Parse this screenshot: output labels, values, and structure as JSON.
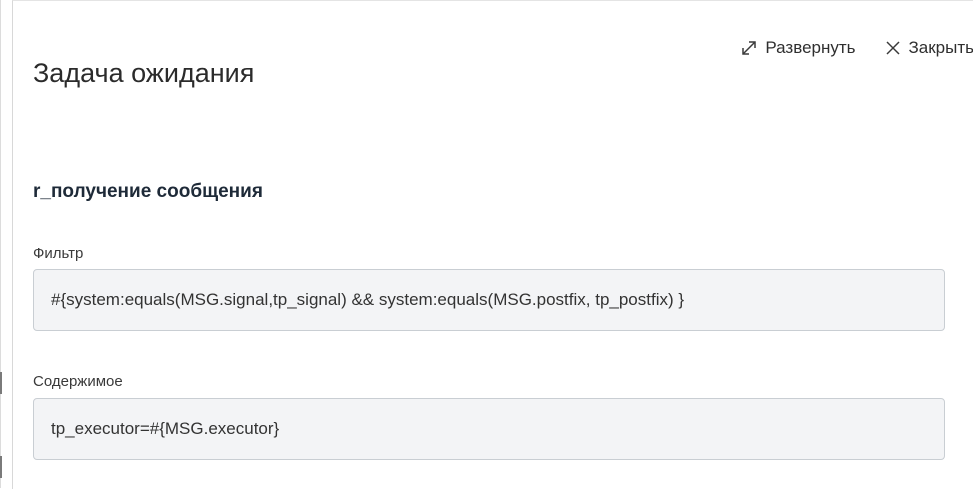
{
  "panel": {
    "title": "Задача ожидания",
    "actions": {
      "expand_label": "Развернуть",
      "close_label": "Закрыть"
    }
  },
  "section": {
    "title": "r_получение сообщения"
  },
  "fields": {
    "filter": {
      "label": "Фильтр",
      "value": "#{system:equals(MSG.signal,tp_signal) && system:equals(MSG.postfix, tp_postfix) }"
    },
    "content": {
      "label": "Содержимое",
      "value": "tp_executor=#{MSG.executor}"
    }
  },
  "icons": {
    "expand": "expand-diagonal-arrows-icon",
    "close": "close-x-icon"
  },
  "colors": {
    "title_text": "#2b2b2b",
    "section_title_text": "#1e2a38",
    "field_background": "#f3f4f6",
    "field_border": "#c9ced3"
  }
}
